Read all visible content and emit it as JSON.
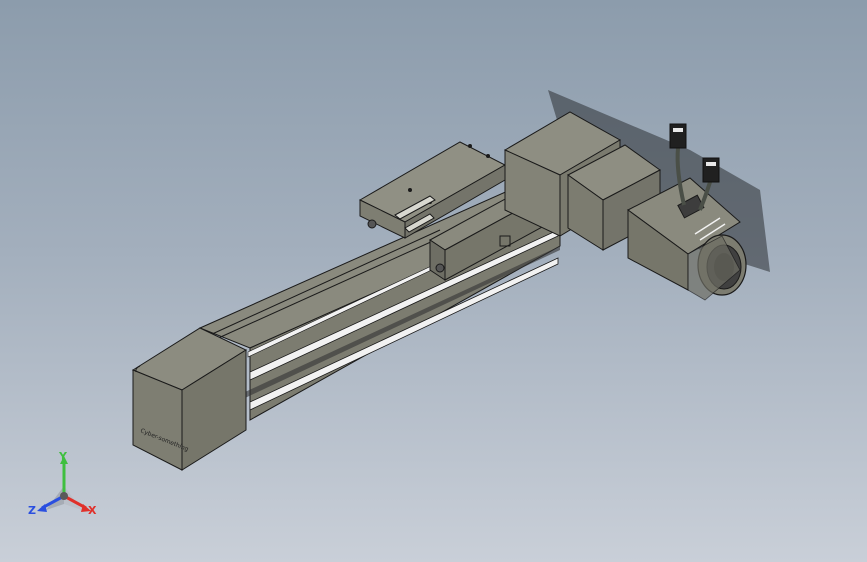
{
  "viewport": {
    "name": "CAD 3D model view",
    "background_top": "#8c9cac",
    "background_bottom": "#c9cfd8"
  },
  "model": {
    "body_color": "#858578",
    "edge_color": "#1a1a1a",
    "highlight_color": "#f2f2f2",
    "cable_color": "#4a4f47",
    "engraved_text": "Cyber-something"
  },
  "triad": {
    "axes": [
      {
        "id": "y",
        "label": "Y",
        "color": "#3fbf3f"
      },
      {
        "id": "x",
        "label": "X",
        "color": "#e0302a"
      },
      {
        "id": "z",
        "label": "Z",
        "color": "#2a4fe0"
      }
    ]
  }
}
